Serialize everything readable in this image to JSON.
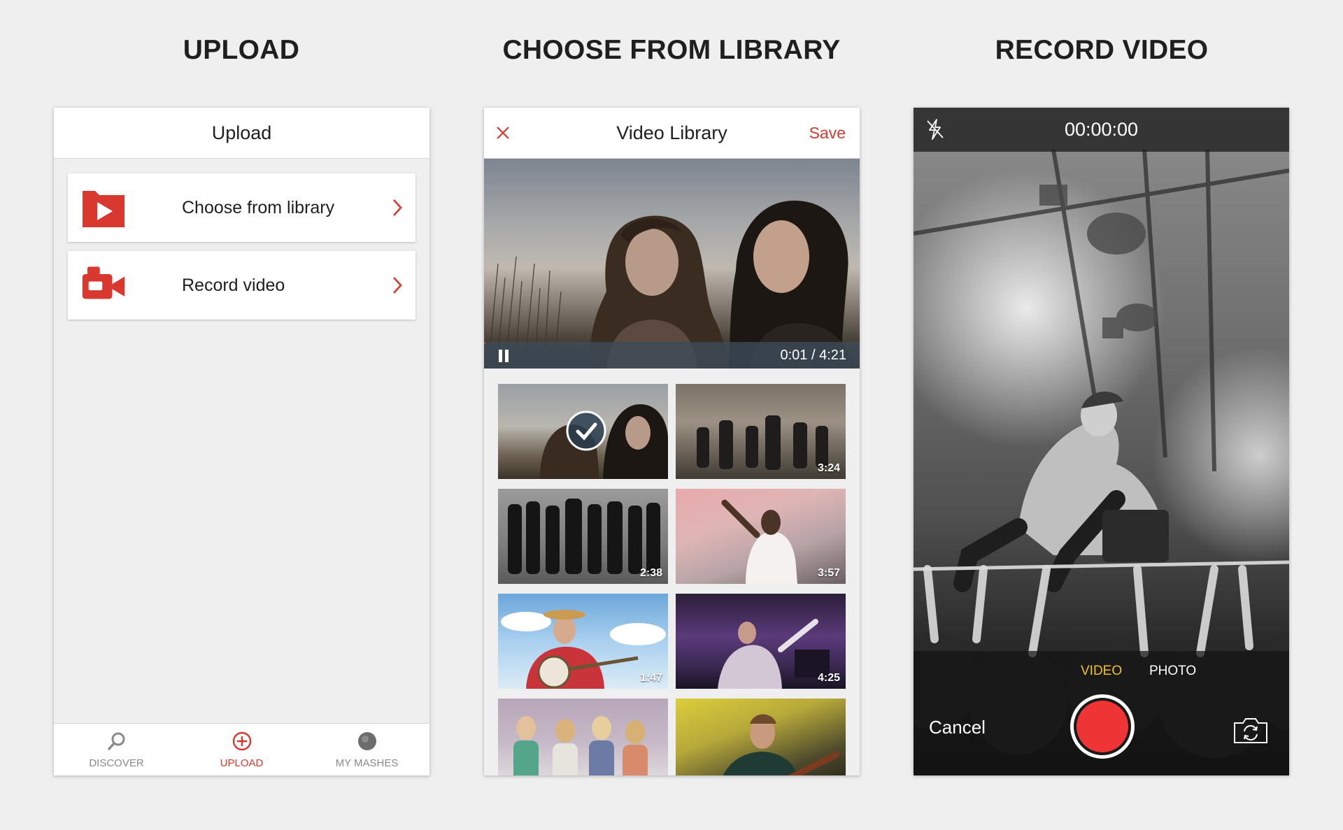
{
  "headings": {
    "upload": "UPLOAD",
    "library": "CHOOSE FROM LIBRARY",
    "record": "RECORD VIDEO"
  },
  "upload_screen": {
    "title": "Upload",
    "options": [
      {
        "label": "Choose from library",
        "icon": "folder-play-icon"
      },
      {
        "label": "Record video",
        "icon": "video-camera-icon"
      }
    ],
    "tabs": [
      {
        "label": "DISCOVER",
        "icon": "search-icon",
        "active": false
      },
      {
        "label": "UPLOAD",
        "icon": "plus-circle-icon",
        "active": true
      },
      {
        "label": "MY MASHES",
        "icon": "avatar-icon",
        "active": false
      }
    ],
    "accent_color": "#d9382f"
  },
  "library_screen": {
    "title": "Video Library",
    "save_label": "Save",
    "player": {
      "timecode": "0:01 / 4:21",
      "progress": 0.004
    },
    "thumbnails": [
      {
        "duration": "",
        "selected": true
      },
      {
        "duration": "3:24",
        "selected": false
      },
      {
        "duration": "2:38",
        "selected": false
      },
      {
        "duration": "3:57",
        "selected": false
      },
      {
        "duration": "1:47",
        "selected": false
      },
      {
        "duration": "4:25",
        "selected": false
      },
      {
        "duration": "",
        "selected": false
      },
      {
        "duration": "",
        "selected": false
      }
    ]
  },
  "record_screen": {
    "timer": "00:00:00",
    "modes": {
      "video": "VIDEO",
      "photo": "PHOTO"
    },
    "active_mode": "VIDEO",
    "cancel_label": "Cancel",
    "record_color": "#ee3434",
    "active_mode_color": "#f2c21b"
  }
}
